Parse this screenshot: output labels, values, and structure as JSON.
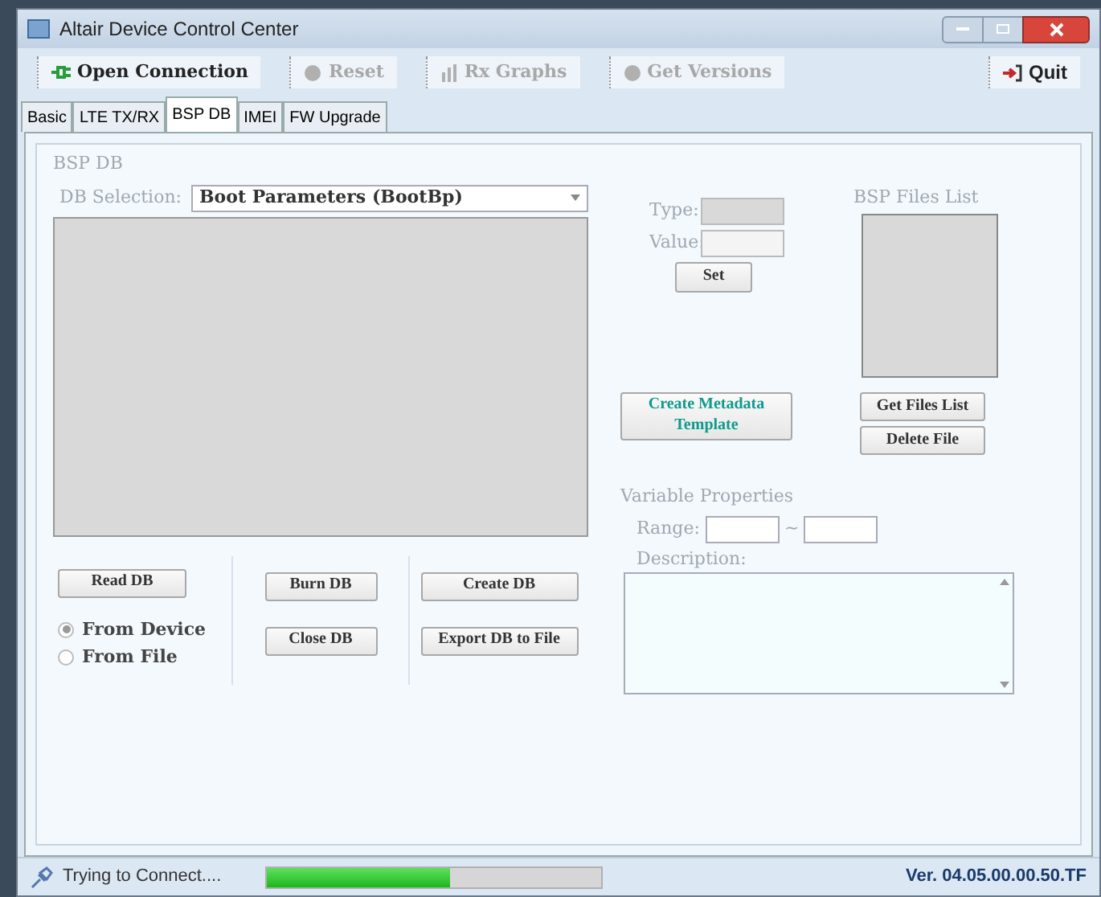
{
  "window": {
    "title": "Altair Device Control Center"
  },
  "toolbar": [
    {
      "label": "Open Connection",
      "disabled": false,
      "kind": "plug"
    },
    {
      "label": "Reset",
      "disabled": true,
      "kind": "dot"
    },
    {
      "label": "Rx Graphs",
      "disabled": true,
      "kind": "chart"
    },
    {
      "label": "Get Versions",
      "disabled": true,
      "kind": "dot"
    }
  ],
  "quit": {
    "label": "Quit"
  },
  "tabs": [
    {
      "label": "Basic",
      "selected": false
    },
    {
      "label": "LTE TX/RX",
      "selected": false
    },
    {
      "label": "BSP DB",
      "selected": true
    },
    {
      "label": "IMEI",
      "selected": false
    },
    {
      "label": "FW Upgrade",
      "selected": false
    }
  ],
  "panel": {
    "title": "BSP DB",
    "db_selection_label": "DB Selection:",
    "db_selection_value": "Boot Parameters (BootBp)",
    "type_label": "Type:",
    "value_label": "Value:",
    "set_button": "Set",
    "files_title": "BSP Files List",
    "get_files_button": "Get Files List",
    "delete_file_button": "Delete File",
    "metadata_button": "Create Metadata Template",
    "variable_properties": "Variable Properties",
    "range_label": "Range:",
    "range_separator": "~",
    "description_label": "Description:",
    "read_button": "Read DB",
    "sources": [
      {
        "label": "From Device",
        "selected": true
      },
      {
        "label": "From File",
        "selected": false
      }
    ],
    "burn_button": "Burn DB",
    "close_button": "Close DB",
    "create_button": "Create DB",
    "export_button": "Export DB to File"
  },
  "status_bar": {
    "text": "Trying to Connect....",
    "level": 0.55,
    "version": "Ver. 04.05.00.00.50.TF"
  }
}
